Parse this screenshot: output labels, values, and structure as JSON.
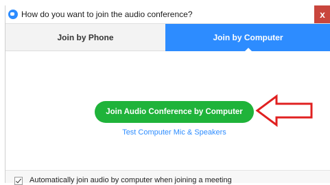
{
  "window": {
    "title": "How do you want to join the audio conference?",
    "close_label": "x"
  },
  "tabs": [
    {
      "label": "Join by Phone",
      "selected": false
    },
    {
      "label": "Join by Computer",
      "selected": true
    }
  ],
  "main": {
    "join_button_label": "Join Audio Conference by Computer",
    "test_link_label": "Test Computer Mic & Speakers"
  },
  "footer": {
    "auto_join_checked": true,
    "auto_join_label": "Automatically join audio by computer when joining a meeting"
  },
  "colors": {
    "accent": "#2d8cff",
    "join_button": "#1fb33a",
    "close_button": "#c9463d",
    "annotation_arrow": "#e02020"
  },
  "icons": {
    "app": "zoom-app-icon",
    "close": "close-icon",
    "annotation": "arrow-left-outline-icon"
  }
}
